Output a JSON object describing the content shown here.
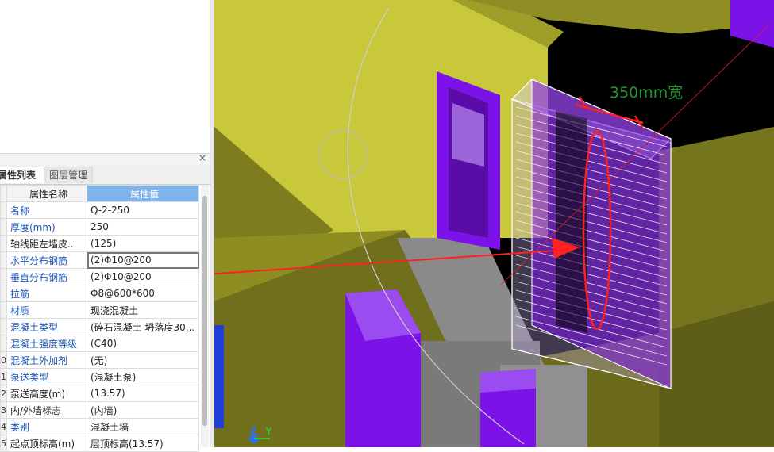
{
  "tabs": {
    "properties": "属性列表",
    "layers": "图层管理"
  },
  "dock": {
    "close_glyph": "×"
  },
  "table": {
    "header_name": "属性名称",
    "header_value": "属性值",
    "rows": [
      {
        "num": "",
        "name": "名称",
        "value": "Q-2-250",
        "link": true
      },
      {
        "num": "",
        "name": "厚度(mm)",
        "value": "250",
        "link": true
      },
      {
        "num": "",
        "name": "轴线距左墙皮...",
        "value": "(125)",
        "link": false
      },
      {
        "num": "",
        "name": "水平分布钢筋",
        "value": "(2)Φ10@200",
        "link": true
      },
      {
        "num": "",
        "name": "垂直分布钢筋",
        "value": "(2)Φ10@200",
        "link": true
      },
      {
        "num": "",
        "name": "拉筋",
        "value": "Φ8@600*600",
        "link": true
      },
      {
        "num": "",
        "name": "材质",
        "value": "现浇混凝土",
        "link": true
      },
      {
        "num": "",
        "name": "混凝土类型",
        "value": "(碎石混凝土 坍落度30...",
        "link": true
      },
      {
        "num": "",
        "name": "混凝土强度等级",
        "value": "(C40)",
        "link": true
      },
      {
        "num": "0",
        "name": "混凝土外加剂",
        "value": "(无)",
        "link": true
      },
      {
        "num": "1",
        "name": "泵送类型",
        "value": "(混凝土泵)",
        "link": true
      },
      {
        "num": "2",
        "name": "泵送高度(m)",
        "value": "(13.57)",
        "link": false
      },
      {
        "num": "3",
        "name": "内/外墙标志",
        "value": "(内墙)",
        "link": false
      },
      {
        "num": "4",
        "name": "类别",
        "value": "混凝土墙",
        "link": true
      },
      {
        "num": "5",
        "name": "起点顶标高(m)",
        "value": "层顶标高(13.57)",
        "link": false
      }
    ]
  },
  "viewport": {
    "annotation_label": "350mm宽",
    "axis_z": "Z",
    "axis_y": "Y",
    "colors": {
      "yellow_wall": "#c8c83a",
      "purple_column": "#7b12e8",
      "annotation_red": "#ff2020",
      "annotation_green": "#1e9a2d"
    }
  }
}
